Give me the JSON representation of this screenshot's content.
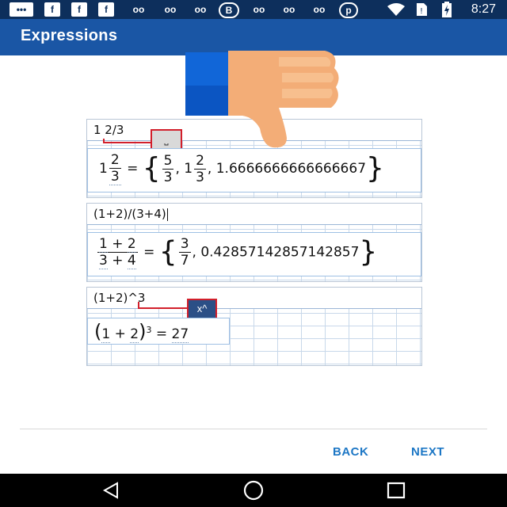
{
  "status_bar": {
    "time": "8:27",
    "icons": [
      "chat-icon",
      "facebook-icon",
      "facebook-icon",
      "facebook-icon",
      "voicemail-icon",
      "voicemail-icon",
      "voicemail-icon",
      "bbm-icon",
      "voicemail-icon",
      "voicemail-icon",
      "voicemail-icon",
      "pinterest-icon",
      "wifi-icon",
      "no-sim-icon",
      "battery-charging-icon"
    ]
  },
  "app_bar": {
    "title": "Expressions"
  },
  "expressions": [
    {
      "input": "1 2/3",
      "key_hint": "⎵",
      "result": {
        "whole": "1",
        "num": "2",
        "den": "3",
        "eq": "=",
        "alt1_num": "5",
        "alt1_den": "3",
        "alt2_whole": "1",
        "alt2_num": "2",
        "alt2_den": "3",
        "decimal": "1.6666666666666667"
      }
    },
    {
      "input": "(1+2)/(3+4)",
      "result": {
        "num_a": "1",
        "op_num": "+",
        "num_b": "2",
        "den_a": "3",
        "op_den": "+",
        "den_b": "4",
        "eq": "=",
        "alt_num": "3",
        "alt_den": "7",
        "decimal": "0.42857142857142857"
      }
    },
    {
      "input": "(1+2)^3",
      "key_hint": "x^",
      "result": {
        "lparen": "(",
        "a": "1",
        "op": "+",
        "b": "2",
        "rparen": ")",
        "exp": "3",
        "eq": "=",
        "value": "27"
      }
    }
  ],
  "nav": {
    "back_label": "BACK",
    "next_label": "NEXT"
  },
  "colors": {
    "status_bar": "#0d2f5c",
    "app_bar": "#1a56a5",
    "accent": "#1d77c5",
    "highlight_red": "#d21f2b"
  }
}
